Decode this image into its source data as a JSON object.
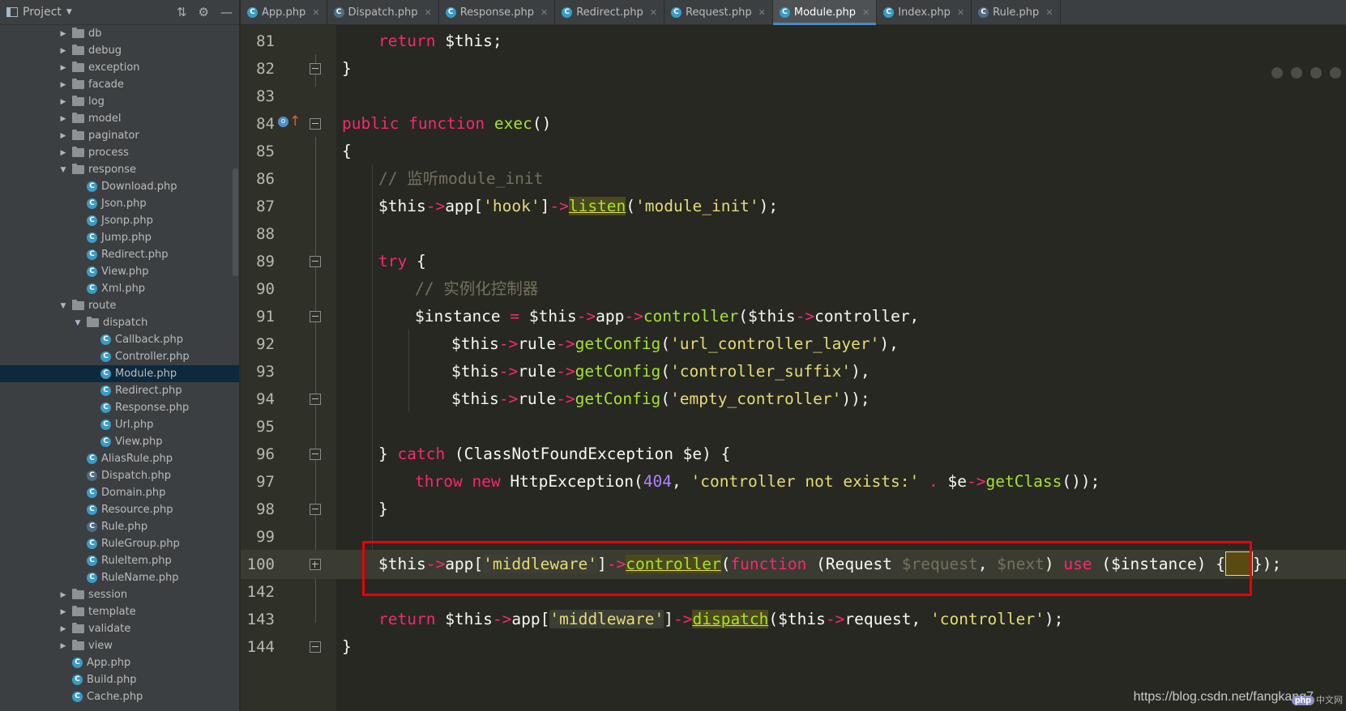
{
  "sidebar": {
    "title": "Project",
    "tree": [
      {
        "label": "db",
        "type": "folder",
        "expanded": false
      },
      {
        "label": "debug",
        "type": "folder",
        "expanded": false
      },
      {
        "label": "exception",
        "type": "folder",
        "expanded": false
      },
      {
        "label": "facade",
        "type": "folder",
        "expanded": false
      },
      {
        "label": "log",
        "type": "folder",
        "expanded": false
      },
      {
        "label": "model",
        "type": "folder",
        "expanded": false
      },
      {
        "label": "paginator",
        "type": "folder",
        "expanded": false
      },
      {
        "label": "process",
        "type": "folder",
        "expanded": false
      },
      {
        "label": "response",
        "type": "folder",
        "expanded": true
      },
      {
        "label": "Download.php",
        "type": "class"
      },
      {
        "label": "Json.php",
        "type": "class"
      },
      {
        "label": "Jsonp.php",
        "type": "class"
      },
      {
        "label": "Jump.php",
        "type": "class"
      },
      {
        "label": "Redirect.php",
        "type": "class"
      },
      {
        "label": "View.php",
        "type": "class"
      },
      {
        "label": "Xml.php",
        "type": "class"
      },
      {
        "label": "route",
        "type": "folder",
        "expanded": true
      },
      {
        "label": "dispatch",
        "type": "folder",
        "expanded": true
      },
      {
        "label": "Callback.php",
        "type": "class"
      },
      {
        "label": "Controller.php",
        "type": "class"
      },
      {
        "label": "Module.php",
        "type": "class",
        "selected": true
      },
      {
        "label": "Redirect.php",
        "type": "class"
      },
      {
        "label": "Response.php",
        "type": "class"
      },
      {
        "label": "Url.php",
        "type": "class"
      },
      {
        "label": "View.php",
        "type": "class"
      },
      {
        "label": "AliasRule.php",
        "type": "class"
      },
      {
        "label": "Dispatch.php",
        "type": "abstract"
      },
      {
        "label": "Domain.php",
        "type": "class"
      },
      {
        "label": "Resource.php",
        "type": "class"
      },
      {
        "label": "Rule.php",
        "type": "abstract"
      },
      {
        "label": "RuleGroup.php",
        "type": "class"
      },
      {
        "label": "RuleItem.php",
        "type": "class"
      },
      {
        "label": "RuleName.php",
        "type": "class"
      },
      {
        "label": "session",
        "type": "folder",
        "expanded": false
      },
      {
        "label": "template",
        "type": "folder",
        "expanded": false
      },
      {
        "label": "validate",
        "type": "folder",
        "expanded": false
      },
      {
        "label": "view",
        "type": "folder",
        "expanded": false
      },
      {
        "label": "App.php",
        "type": "class"
      },
      {
        "label": "Build.php",
        "type": "class"
      },
      {
        "label": "Cache.php",
        "type": "class"
      }
    ]
  },
  "tabs": [
    {
      "label": "App.php",
      "icon": "class",
      "active": false
    },
    {
      "label": "Dispatch.php",
      "icon": "abstract",
      "active": false
    },
    {
      "label": "Response.php",
      "icon": "class",
      "active": false
    },
    {
      "label": "Redirect.php",
      "icon": "class",
      "active": false
    },
    {
      "label": "Request.php",
      "icon": "class",
      "active": false
    },
    {
      "label": "Module.php",
      "icon": "class",
      "active": true
    },
    {
      "label": "Index.php",
      "icon": "class",
      "active": false
    },
    {
      "label": "Rule.php",
      "icon": "abstract",
      "active": false
    }
  ],
  "editor": {
    "line_numbers": [
      "81",
      "82",
      "83",
      "84",
      "85",
      "86",
      "87",
      "88",
      "89",
      "90",
      "91",
      "92",
      "93",
      "94",
      "95",
      "96",
      "97",
      "98",
      "99",
      "100",
      "142",
      "143",
      "144"
    ],
    "current_line": "100",
    "watermark": "https://blog.csdn.net/fangkang7",
    "badge_text": "php",
    "badge_site": "中文网"
  },
  "colors": {
    "editor_bg": "#272822",
    "keyword": "#f92672",
    "function": "#a6e22e",
    "string": "#e6db74",
    "number": "#ae81ff",
    "comment": "#75715e",
    "highlight_box": "#e8000b",
    "active_tab_underline": "#4a88c7"
  }
}
